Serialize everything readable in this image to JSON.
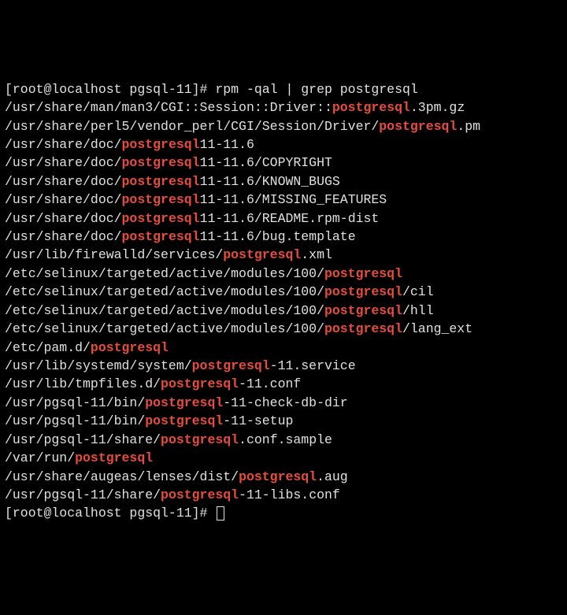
{
  "prompt1": {
    "pre": "[root@localhost pgsql-11]# ",
    "cmd": "rpm -qal | grep postgresql"
  },
  "l1": {
    "a": "/usr/share/man/man3/CGI::Session::Driver::",
    "h": "postgresql",
    "b": ".3pm.gz"
  },
  "l2": {
    "a": "/usr/share/perl5/vendor_perl/CGI/Session/Driver/",
    "h": "postgresql",
    "b": ".pm"
  },
  "l3": {
    "a": "/usr/share/doc/",
    "h": "postgresql",
    "b": "11-11.6"
  },
  "l4": {
    "a": "/usr/share/doc/",
    "h": "postgresql",
    "b": "11-11.6/COPYRIGHT"
  },
  "l5": {
    "a": "/usr/share/doc/",
    "h": "postgresql",
    "b": "11-11.6/KNOWN_BUGS"
  },
  "l6": {
    "a": "/usr/share/doc/",
    "h": "postgresql",
    "b": "11-11.6/MISSING_FEATURES"
  },
  "l7": {
    "a": "/usr/share/doc/",
    "h": "postgresql",
    "b": "11-11.6/README.rpm-dist"
  },
  "l8": {
    "a": "/usr/share/doc/",
    "h": "postgresql",
    "b": "11-11.6/bug.template"
  },
  "l9": {
    "a": "/usr/lib/firewalld/services/",
    "h": "postgresql",
    "b": ".xml"
  },
  "l10": {
    "a": "/etc/selinux/targeted/active/modules/100/",
    "h": "postgresql",
    "b": ""
  },
  "l11": {
    "a": "/etc/selinux/targeted/active/modules/100/",
    "h": "postgresql",
    "b": "/cil"
  },
  "l12": {
    "a": "/etc/selinux/targeted/active/modules/100/",
    "h": "postgresql",
    "b": "/hll"
  },
  "l13": {
    "a": "/etc/selinux/targeted/active/modules/100/",
    "h": "postgresql",
    "b": "/lang_ext"
  },
  "l14": {
    "a": "/etc/pam.d/",
    "h": "postgresql",
    "b": ""
  },
  "l15": {
    "a": "/usr/lib/systemd/system/",
    "h": "postgresql",
    "b": "-11.service"
  },
  "l16": {
    "a": "/usr/lib/tmpfiles.d/",
    "h": "postgresql",
    "b": "-11.conf"
  },
  "l17": {
    "a": "/usr/pgsql-11/bin/",
    "h": "postgresql",
    "b": "-11-check-db-dir"
  },
  "l18": {
    "a": "/usr/pgsql-11/bin/",
    "h": "postgresql",
    "b": "-11-setup"
  },
  "l19": {
    "a": "/usr/pgsql-11/share/",
    "h": "postgresql",
    "b": ".conf.sample"
  },
  "l20": {
    "a": "/var/run/",
    "h": "postgresql",
    "b": ""
  },
  "l21": {
    "a": "/usr/share/augeas/lenses/dist/",
    "h": "postgresql",
    "b": ".aug"
  },
  "l22": {
    "a": "/usr/pgsql-11/share/",
    "h": "postgresql",
    "b": "-11-libs.conf"
  },
  "prompt2": {
    "pre": "[root@localhost pgsql-11]# "
  }
}
